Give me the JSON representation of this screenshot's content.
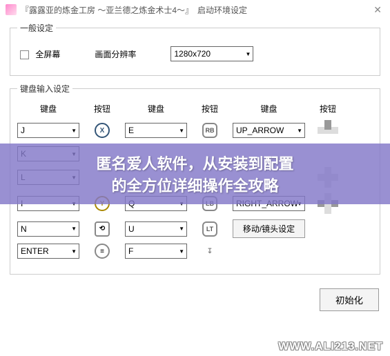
{
  "title": "『露露亚的炼金工房 ～亚兰德之炼金术士4～』　启动环境设定",
  "general": {
    "legend": "一般设定",
    "fullscreen_label": "全屏幕",
    "resolution_label": "画面分辨率",
    "resolution_value": "1280x720"
  },
  "keyboard": {
    "legend": "键盘输入设定",
    "headers": {
      "kb": "键盘",
      "btn": "按钮"
    },
    "rows": [
      {
        "c1": "J",
        "b1": "X",
        "c2": "E",
        "b2": "RB",
        "c3": "UP_ARROW"
      },
      {
        "c1": "K",
        "b1": "",
        "c2": "",
        "b2": "",
        "c3": ""
      },
      {
        "c1": "L",
        "b1": "",
        "c2": "",
        "b2": "",
        "c3": ""
      },
      {
        "c1": "I",
        "b1": "Y",
        "c2": "Q",
        "b2": "LB",
        "c3": "RIGHT_ARROW"
      },
      {
        "c1": "N",
        "b1": "⟲",
        "c2": "U",
        "b2": "LT",
        "c3_btn": "移动/镜头设定"
      },
      {
        "c1": "ENTER",
        "b1": "≡",
        "c2": "F",
        "b2": "↧"
      }
    ]
  },
  "init_button": "初始化",
  "overlay": {
    "line1": "匿名爱人软件，从安装到配置",
    "line2": "的全方位详细操作全攻略"
  },
  "watermark": "WWW.ALI213.NET"
}
